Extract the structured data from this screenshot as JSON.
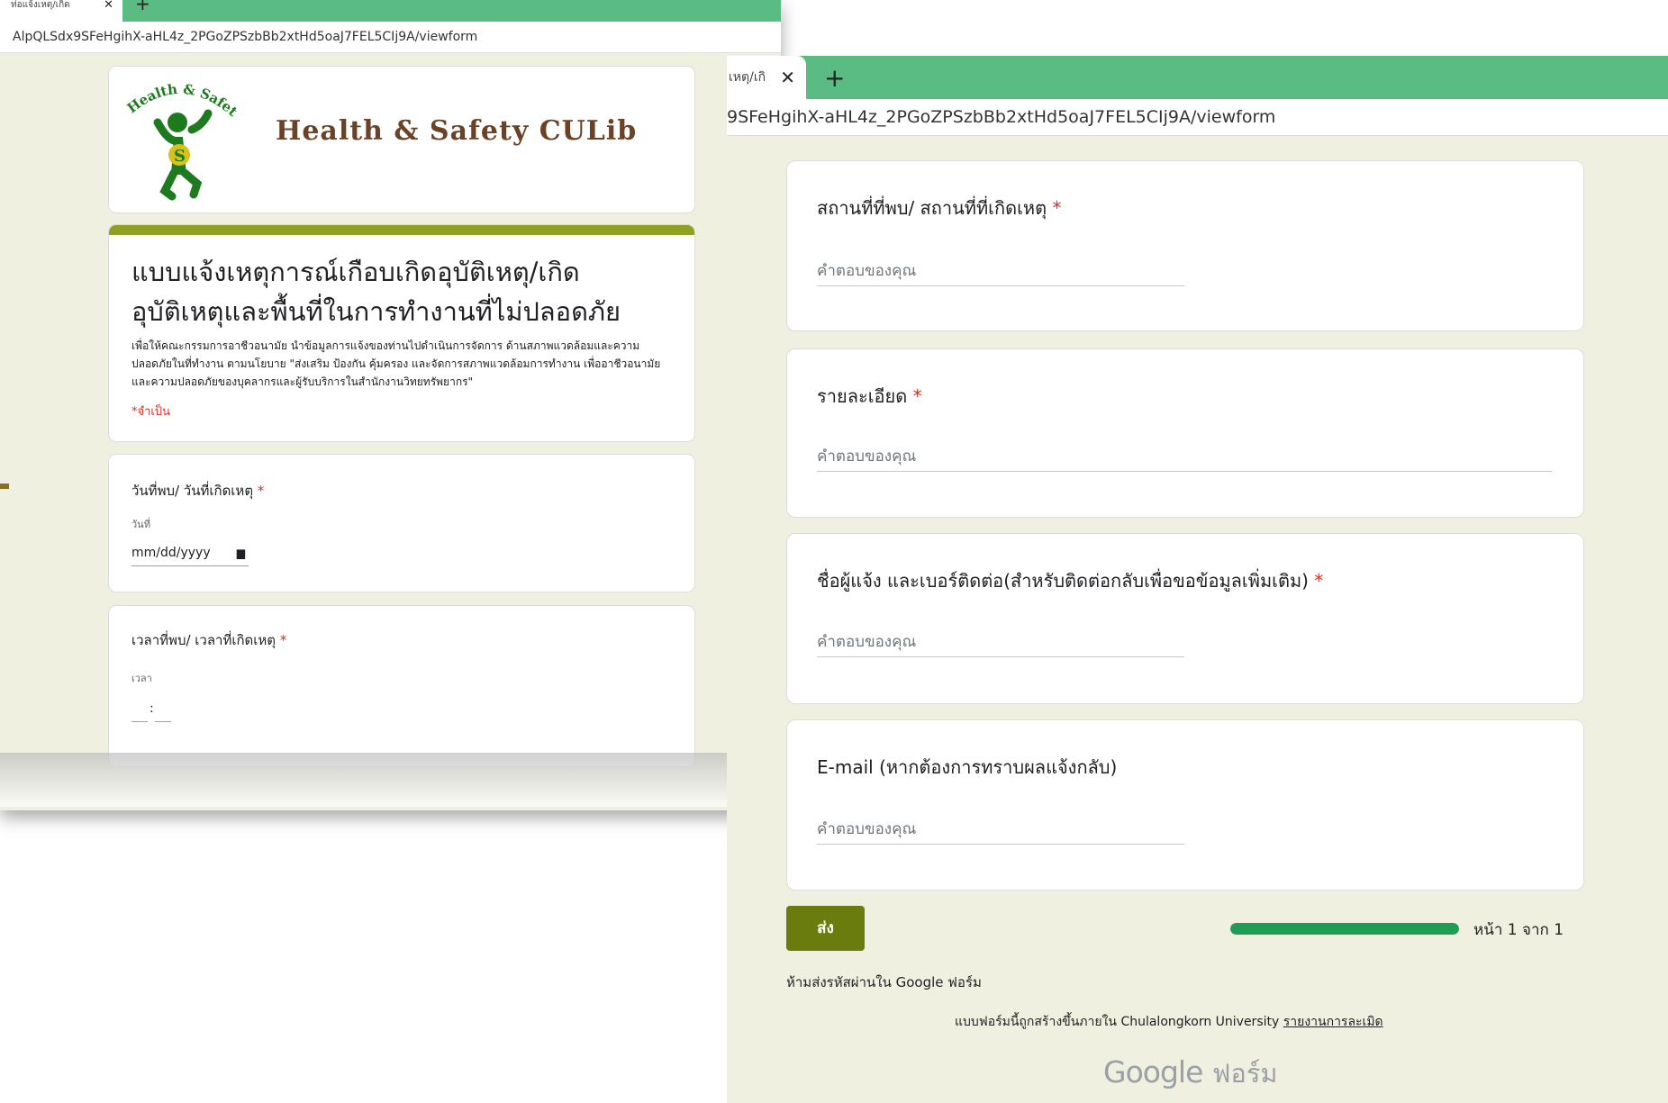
{
  "left_window": {
    "tab_title": "ท่อแจ้งเหตุ/เกิด",
    "url": "AlpQLSdx9SFeHgihX-aHL4z_2PGoZPSzbBb2xtHd5oaJ7FEL5CIj9A/viewform",
    "logo": {
      "arc_text": "Health & Safety",
      "title": "Health & Safety CULib"
    },
    "form": {
      "title": "แบบแจ้งเหตุการณ์เกือบเกิดอุบัติเหตุ/เกิดอุบัติเหตุและพื้นที่ในการทำงานที่ไม่ปลอดภัย",
      "description": "เพื่อให้คณะกรรมการอาชีวอนามัย นำข้อมูลการแจ้งของท่านไปดำเนินการจัดการ ด้านสภาพแวดล้อมและความปลอดภัยในที่ทำงาน ตามนโยบาย \"ส่งเสริม ป้องกัน คุ้มครอง และจัดการสภาพแวดล้อมการทำงาน เพื่ออาชีวอนามัยและความปลอดภัยของบุคลากรและผู้รับบริการในสำนักงานวิทยทรัพยากร\"",
      "required_note": "*จำเป็น"
    },
    "date_question": {
      "label": "วันที่พบ/ วันที่เกิดเหตุ",
      "star": "*",
      "sublabel": "วันที่",
      "placeholder": "mm/dd/yyyy",
      "calendar_icon": "calendar-icon"
    },
    "time_question": {
      "label": "เวลาที่พบ/ เวลาที่เกิดเหตุ",
      "star": "*",
      "sublabel": "เวลา",
      "colon": ":"
    }
  },
  "right_window": {
    "tab_title": "เหตุ/เกิ",
    "url": "9SFeHgihX-aHL4z_2PGoZPSzbBb2xtHd5oaJ7FEL5CIj9A/viewform",
    "questions": [
      {
        "label": "สถานที่ที่พบ/ สถานที่ที่เกิดเหตุ",
        "star": "*",
        "placeholder": "คำตอบของคุณ"
      },
      {
        "label": "รายละเอียด",
        "star": "*",
        "placeholder": "คำตอบของคุณ"
      },
      {
        "label": "ชื่อผู้แจ้ง และเบอร์ติดต่อ(สำหรับติดต่อกลับเพื่อขอข้อมูลเพิ่มเติม)",
        "star": "*",
        "placeholder": "คำตอบของคุณ"
      },
      {
        "label": "E-mail (หากต้องการทราบผลแจ้งกลับ)",
        "star": "",
        "placeholder": "คำตอบของคุณ"
      }
    ],
    "submit_label": "ส่ง",
    "progress_fraction": 1.0,
    "page_indicator": "หน้า 1 จาก 1",
    "password_warning": "ห้ามส่งรหัสผ่านใน Google ฟอร์ม",
    "footer_text": "แบบฟอร์มนี้ถูกสร้างขึ้นภายใน Chulalongkorn University",
    "report_link": "รายงานการละเมิด",
    "brand_google": "Google",
    "brand_forms": "ฟอร์ม"
  },
  "colors": {
    "tab_green": "#5abb83",
    "form_bg": "#f0f0e0",
    "accent_olive": "#8ea122",
    "submit_bg": "#6b7c0e",
    "progress_fill": "#1f9d55",
    "required_red": "#d93025",
    "logo_green": "#1e7a1e",
    "logo_brown": "#6b4226"
  }
}
